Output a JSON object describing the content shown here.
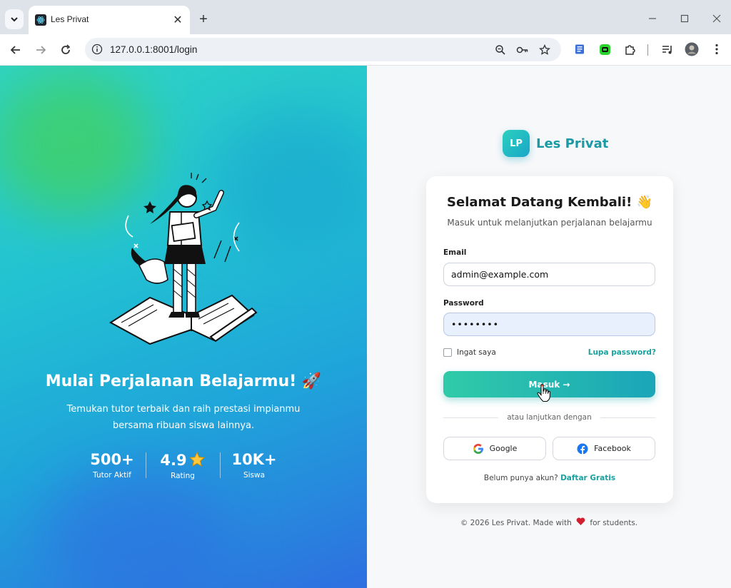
{
  "browser": {
    "tab_title": "Les Privat",
    "url": "127.0.0.1:8001/login"
  },
  "hero": {
    "title": "Mulai Perjalanan Belajarmu! 🚀",
    "subtitle": "Temukan tutor terbaik dan raih prestasi impianmu bersama ribuan siswa lainnya.",
    "stats": [
      {
        "value": "500+",
        "label": "Tutor Aktif"
      },
      {
        "value": "4.9",
        "label": "Rating",
        "icon": "star-icon"
      },
      {
        "value": "10K+",
        "label": "Siswa"
      }
    ]
  },
  "brand": {
    "logo_text": "LP",
    "name": "Les Privat"
  },
  "login": {
    "title": "Selamat Datang Kembali! 👋",
    "subtitle": "Masuk untuk melanjutkan perjalanan belajarmu",
    "email_label": "Email",
    "email_value": "admin@example.com",
    "password_label": "Password",
    "password_value": "••••••••",
    "remember_label": "Ingat saya",
    "forgot_label": "Lupa password?",
    "submit_label": "Masuk →",
    "divider_text": "atau lanjutkan dengan",
    "google_label": "Google",
    "facebook_label": "Facebook",
    "signup_prompt": "Belum punya akun?",
    "signup_link": "Daftar Gratis"
  },
  "footer": {
    "before": "© 2026 Les Privat. Made with",
    "after": "for students."
  },
  "colors": {
    "accent": "#1b9aa6",
    "link": "#17a2a0",
    "hero_start": "#2fd3c4",
    "hero_end": "#2e6fe0"
  }
}
